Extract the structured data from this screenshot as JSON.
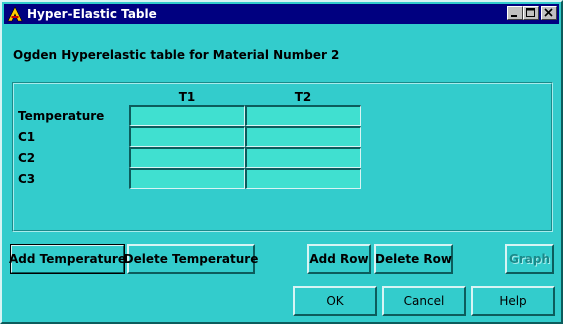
{
  "window": {
    "title": "Hyper-Elastic Table",
    "icon": "ansys-logo-icon",
    "controls": [
      "minimize-icon",
      "maximize-icon",
      "close-icon"
    ]
  },
  "heading": "Ogden Hyperelastic table for Material Number 2",
  "table": {
    "columns": [
      "T1",
      "T2"
    ],
    "rows": [
      {
        "label": "Temperature",
        "values": [
          "",
          ""
        ]
      },
      {
        "label": "C1",
        "values": [
          "",
          ""
        ]
      },
      {
        "label": "C2",
        "values": [
          "",
          ""
        ]
      },
      {
        "label": "C3",
        "values": [
          "",
          ""
        ]
      }
    ]
  },
  "buttons": {
    "add_temperature": "Add Temperature",
    "delete_temperature": "Delete Temperature",
    "add_row": "Add Row",
    "delete_row": "Delete Row",
    "graph": "Graph",
    "ok": "OK",
    "cancel": "Cancel",
    "help": "Help"
  },
  "colors": {
    "dialog_background": "#33cccc",
    "cell_background": "#40e0d0",
    "title_bar": "#000080"
  }
}
